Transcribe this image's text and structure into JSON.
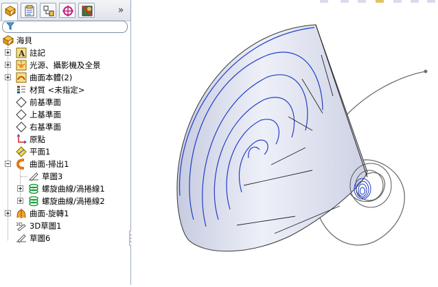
{
  "filter": {
    "placeholder": ""
  },
  "tabs": [
    {
      "name": "feature-manager-tab"
    },
    {
      "name": "property-manager-tab"
    },
    {
      "name": "configuration-manager-tab"
    },
    {
      "name": "dimxpert-tab"
    },
    {
      "name": "display-manager-tab"
    }
  ],
  "tree": {
    "root": "海貝",
    "items": [
      {
        "label": "註記",
        "icon": "annotation-icon",
        "expandable": true
      },
      {
        "label": "光源、攝影機及全景",
        "icon": "lights-cameras-icon",
        "expandable": true
      },
      {
        "label": "曲面本體(2)",
        "icon": "surface-bodies-icon",
        "expandable": true
      },
      {
        "label": "材質 <未指定>",
        "icon": "material-icon",
        "expandable": false
      },
      {
        "label": "前基準面",
        "icon": "plane-icon",
        "expandable": false
      },
      {
        "label": "上基準面",
        "icon": "plane-icon",
        "expandable": false
      },
      {
        "label": "右基準面",
        "icon": "plane-icon",
        "expandable": false
      },
      {
        "label": "原點",
        "icon": "origin-icon",
        "expandable": false
      },
      {
        "label": "平面1",
        "icon": "plane-feature-icon",
        "expandable": false
      },
      {
        "label": "曲面-掃出1",
        "icon": "surface-sweep-icon",
        "expandable": "open"
      },
      {
        "label": "草圖3",
        "icon": "sketch-icon",
        "child": true
      },
      {
        "label": "螺旋曲線/渦捲線1",
        "icon": "helix-icon",
        "child": true,
        "expandable": true
      },
      {
        "label": "螺旋曲線/渦捲線2",
        "icon": "helix-icon",
        "child": true,
        "expandable": true
      },
      {
        "label": "曲面-旋轉1",
        "icon": "surface-revolve-icon",
        "expandable": true
      },
      {
        "label": "3D草圖1",
        "icon": "3d-sketch-icon",
        "expandable": false
      },
      {
        "label": "草圖6",
        "icon": "sketch-icon",
        "expandable": false
      }
    ]
  },
  "colors": {
    "accent": "#1f3cc8",
    "surface": "#dfe2f0",
    "panel_border": "#9aa7c0"
  }
}
